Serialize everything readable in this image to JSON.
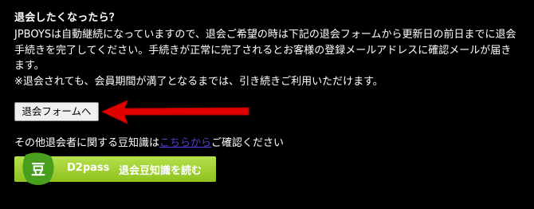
{
  "section": {
    "heading": "退会したくなったら？",
    "lines": [
      "JPBOYSは自動継続になっていますので、退会ご希望の時は下記の退会フォームから更新日の前日までに退会",
      "手続きを完了してください。手続きが正常に完了されるとお客様の登録メールアドレスに確認メールが届き",
      "ます。",
      "※退会されても、会員期間が満了となるまでは、引き続きご利用いただけます。"
    ]
  },
  "cancel_button": {
    "label": "退会フォームへ"
  },
  "trivia": {
    "prefix": "その他退会者に関する豆知識は",
    "link_text": "こちらから",
    "suffix": "ご確認ください"
  },
  "banner": {
    "badge_text": "豆",
    "brand": "D2pass",
    "label": "退会豆知識を読む"
  },
  "colors": {
    "background": "#000000",
    "text": "#ffffff",
    "link": "#5b3bd6",
    "arrow": "#e00000",
    "banner_green": "#9ccb2a",
    "badge_green": "#4a9e1e"
  },
  "icons": {
    "arrow": "red-left-arrow-icon",
    "badge": "green-bean-badge-icon"
  }
}
